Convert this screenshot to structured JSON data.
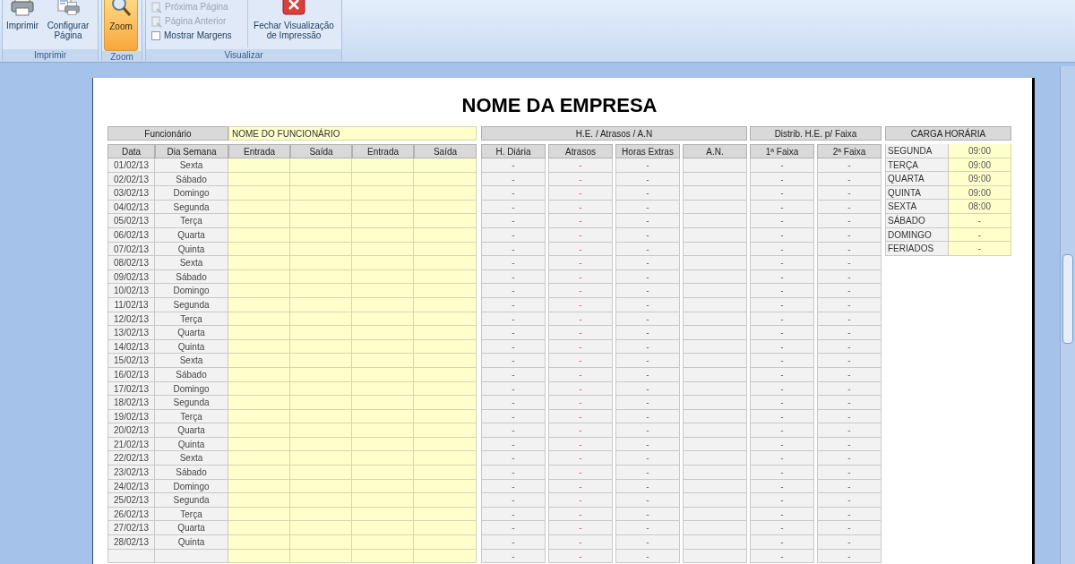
{
  "ribbon": {
    "imprimir_group": {
      "label": "Imprimir",
      "print_button": "Imprimir",
      "page_setup_button": "Configurar Página"
    },
    "zoom_group": {
      "label": "Zoom",
      "zoom_button": {
        "label": "Zoom",
        "selected": true
      }
    },
    "visualizar_group": {
      "label": "Visualizar",
      "next_page": {
        "label": "Próxima Página",
        "disabled": true
      },
      "prev_page": {
        "label": "Página Anterior",
        "disabled": true
      },
      "show_margins": {
        "label": "Mostrar Margens",
        "checked": false
      },
      "close_button": "Fechar Visualização de Impressão"
    }
  },
  "sheet": {
    "title": "NOME DA EMPRESA",
    "employee_label": "Funcionário",
    "employee_name": "NOME DO FUNCIONÁRIO",
    "group_headers": {
      "he": "H.E. / Atrasos / A.N",
      "distrib": "Distrib. H.E. p/ Faixa",
      "carga": "CARGA HORÁRIA"
    },
    "columns": [
      "Data",
      "Dia Semana",
      "Entrada",
      "Saída",
      "Entrada",
      "Saída",
      "H. Diária",
      "Atrasos",
      "Horas Extras",
      "A.N.",
      "1ª Faixa",
      "2ª Faixa"
    ],
    "rows": [
      {
        "date": "01/02/13",
        "weekday": "Sexta",
        "h_diaria": "-",
        "atrasos": "-",
        "horas_extras": "-",
        "faixa_1": "-",
        "faixa_2": "-"
      },
      {
        "date": "02/02/13",
        "weekday": "Sábado",
        "h_diaria": "-",
        "atrasos": "-",
        "horas_extras": "-",
        "faixa_1": "-",
        "faixa_2": "-"
      },
      {
        "date": "03/02/13",
        "weekday": "Domingo",
        "h_diaria": "-",
        "atrasos": "-",
        "horas_extras": "-",
        "faixa_1": "-",
        "faixa_2": "-"
      },
      {
        "date": "04/02/13",
        "weekday": "Segunda",
        "h_diaria": "-",
        "atrasos": "-",
        "horas_extras": "-",
        "faixa_1": "-",
        "faixa_2": "-"
      },
      {
        "date": "05/02/13",
        "weekday": "Terça",
        "h_diaria": "-",
        "atrasos": "-",
        "horas_extras": "-",
        "faixa_1": "-",
        "faixa_2": "-"
      },
      {
        "date": "06/02/13",
        "weekday": "Quarta",
        "h_diaria": "-",
        "atrasos": "-",
        "horas_extras": "-",
        "faixa_1": "-",
        "faixa_2": "-"
      },
      {
        "date": "07/02/13",
        "weekday": "Quinta",
        "h_diaria": "-",
        "atrasos": "-",
        "horas_extras": "-",
        "faixa_1": "-",
        "faixa_2": "-"
      },
      {
        "date": "08/02/13",
        "weekday": "Sexta",
        "h_diaria": "-",
        "atrasos": "-",
        "horas_extras": "-",
        "faixa_1": "-",
        "faixa_2": "-"
      },
      {
        "date": "09/02/13",
        "weekday": "Sábado",
        "h_diaria": "-",
        "atrasos": "-",
        "horas_extras": "-",
        "faixa_1": "-",
        "faixa_2": "-"
      },
      {
        "date": "10/02/13",
        "weekday": "Domingo",
        "h_diaria": "-",
        "atrasos": "-",
        "horas_extras": "-",
        "faixa_1": "-",
        "faixa_2": "-"
      },
      {
        "date": "11/02/13",
        "weekday": "Segunda",
        "h_diaria": "-",
        "atrasos": "-",
        "horas_extras": "-",
        "faixa_1": "-",
        "faixa_2": "-"
      },
      {
        "date": "12/02/13",
        "weekday": "Terça",
        "h_diaria": "-",
        "atrasos": "-",
        "horas_extras": "-",
        "faixa_1": "-",
        "faixa_2": "-"
      },
      {
        "date": "13/02/13",
        "weekday": "Quarta",
        "h_diaria": "-",
        "atrasos": "-",
        "horas_extras": "-",
        "faixa_1": "-",
        "faixa_2": "-"
      },
      {
        "date": "14/02/13",
        "weekday": "Quinta",
        "h_diaria": "-",
        "atrasos": "-",
        "horas_extras": "-",
        "faixa_1": "-",
        "faixa_2": "-"
      },
      {
        "date": "15/02/13",
        "weekday": "Sexta",
        "h_diaria": "-",
        "atrasos": "-",
        "horas_extras": "-",
        "faixa_1": "-",
        "faixa_2": "-"
      },
      {
        "date": "16/02/13",
        "weekday": "Sábado",
        "h_diaria": "-",
        "atrasos": "-",
        "horas_extras": "-",
        "faixa_1": "-",
        "faixa_2": "-"
      },
      {
        "date": "17/02/13",
        "weekday": "Domingo",
        "h_diaria": "-",
        "atrasos": "-",
        "horas_extras": "-",
        "faixa_1": "-",
        "faixa_2": "-"
      },
      {
        "date": "18/02/13",
        "weekday": "Segunda",
        "h_diaria": "-",
        "atrasos": "-",
        "horas_extras": "-",
        "faixa_1": "-",
        "faixa_2": "-"
      },
      {
        "date": "19/02/13",
        "weekday": "Terça",
        "h_diaria": "-",
        "atrasos": "-",
        "horas_extras": "-",
        "faixa_1": "-",
        "faixa_2": "-"
      },
      {
        "date": "20/02/13",
        "weekday": "Quarta",
        "h_diaria": "-",
        "atrasos": "-",
        "horas_extras": "-",
        "faixa_1": "-",
        "faixa_2": "-"
      },
      {
        "date": "21/02/13",
        "weekday": "Quinta",
        "h_diaria": "-",
        "atrasos": "-",
        "horas_extras": "-",
        "faixa_1": "-",
        "faixa_2": "-"
      },
      {
        "date": "22/02/13",
        "weekday": "Sexta",
        "h_diaria": "-",
        "atrasos": "-",
        "horas_extras": "-",
        "faixa_1": "-",
        "faixa_2": "-"
      },
      {
        "date": "23/02/13",
        "weekday": "Sábado",
        "h_diaria": "-",
        "atrasos": "-",
        "horas_extras": "-",
        "faixa_1": "-",
        "faixa_2": "-"
      },
      {
        "date": "24/02/13",
        "weekday": "Domingo",
        "h_diaria": "-",
        "atrasos": "-",
        "horas_extras": "-",
        "faixa_1": "-",
        "faixa_2": "-"
      },
      {
        "date": "25/02/13",
        "weekday": "Segunda",
        "h_diaria": "-",
        "atrasos": "-",
        "horas_extras": "-",
        "faixa_1": "-",
        "faixa_2": "-"
      },
      {
        "date": "26/02/13",
        "weekday": "Terça",
        "h_diaria": "-",
        "atrasos": "-",
        "horas_extras": "-",
        "faixa_1": "-",
        "faixa_2": "-"
      },
      {
        "date": "27/02/13",
        "weekday": "Quarta",
        "h_diaria": "-",
        "atrasos": "-",
        "horas_extras": "-",
        "faixa_1": "-",
        "faixa_2": "-"
      },
      {
        "date": "28/02/13",
        "weekday": "Quinta",
        "h_diaria": "-",
        "atrasos": "-",
        "horas_extras": "-",
        "faixa_1": "-",
        "faixa_2": "-"
      },
      {
        "h_diaria": "-",
        "atrasos": "-",
        "horas_extras": "-",
        "faixa_1": "-",
        "faixa_2": "-"
      }
    ],
    "carga_horaria": [
      {
        "day": "SEGUNDA",
        "hours": "09:00"
      },
      {
        "day": "TERÇA",
        "hours": "09:00"
      },
      {
        "day": "QUARTA",
        "hours": "09:00"
      },
      {
        "day": "QUINTA",
        "hours": "09:00"
      },
      {
        "day": "SEXTA",
        "hours": "08:00"
      },
      {
        "day": "SÁBADO",
        "hours": "-"
      },
      {
        "day": "DOMINGO",
        "hours": "-"
      },
      {
        "day": "FERIADOS",
        "hours": "-"
      }
    ]
  }
}
